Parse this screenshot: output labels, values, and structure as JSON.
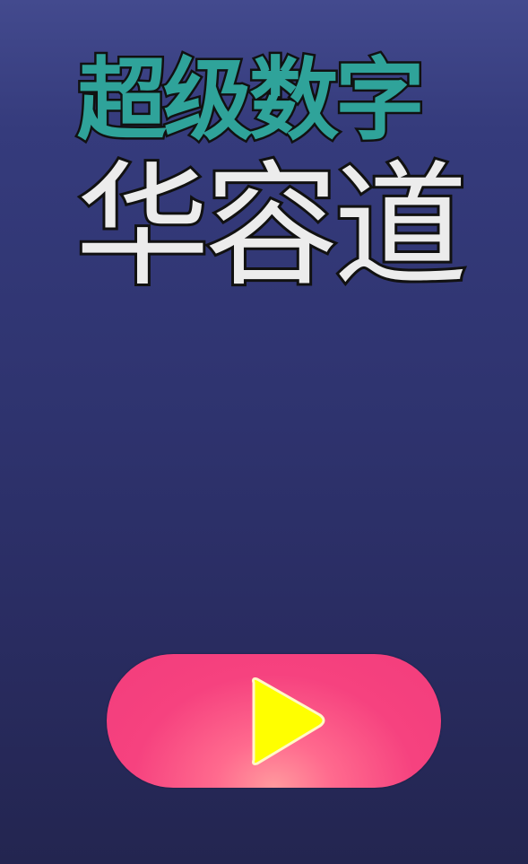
{
  "title": {
    "line1": "超级数字",
    "line2": "华容道"
  },
  "play_button": {
    "icon": "play-icon",
    "icon_color": "#ffff00",
    "button_color": "#f23d7c"
  },
  "colors": {
    "title_line1": "#2fa39a",
    "title_line2": "#ececec",
    "background_top": "#434a8e",
    "background_bottom": "#232550"
  }
}
